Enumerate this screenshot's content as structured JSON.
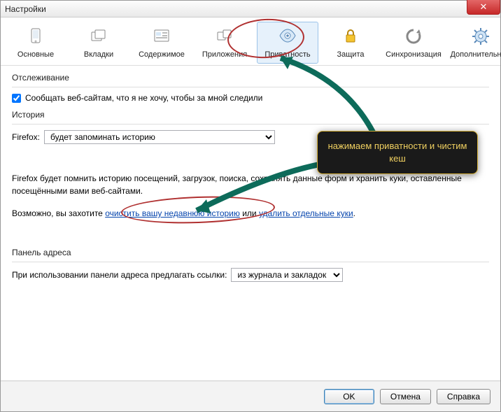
{
  "window": {
    "title": "Настройки"
  },
  "toolbar": {
    "tabs": [
      {
        "label": "Основные"
      },
      {
        "label": "Вкладки"
      },
      {
        "label": "Содержимое"
      },
      {
        "label": "Приложения"
      },
      {
        "label": "Приватность"
      },
      {
        "label": "Защита"
      },
      {
        "label": "Синхронизация"
      },
      {
        "label": "Дополнительные"
      }
    ]
  },
  "tracking": {
    "section": "Отслеживание",
    "checkbox_label": "Сообщать веб-сайтам, что я не хочу, чтобы за мной следили",
    "checked": true
  },
  "history": {
    "section": "История",
    "field_label": "Firefox:",
    "select_value": "будет запоминать историю",
    "desc1": "Firefox будет помнить историю посещений, загрузок, поиска, сохранять данные форм и хранить куки, оставленные посещёнными вами веб-сайтами.",
    "desc2_prefix": "Возможно, вы захотите ",
    "desc2_link1": "очистить вашу недавнюю историю",
    "desc2_middle": " или ",
    "desc2_link2": "удалить отдельные куки",
    "desc2_suffix": "."
  },
  "addressbar": {
    "section": "Панель адреса",
    "label": "При использовании панели адреса предлагать ссылки:",
    "select_value": "из журнала и закладок"
  },
  "buttons": {
    "ok": "OK",
    "cancel": "Отмена",
    "help": "Справка"
  },
  "callout": {
    "text": "нажимаем приватности и чистим кеш"
  }
}
